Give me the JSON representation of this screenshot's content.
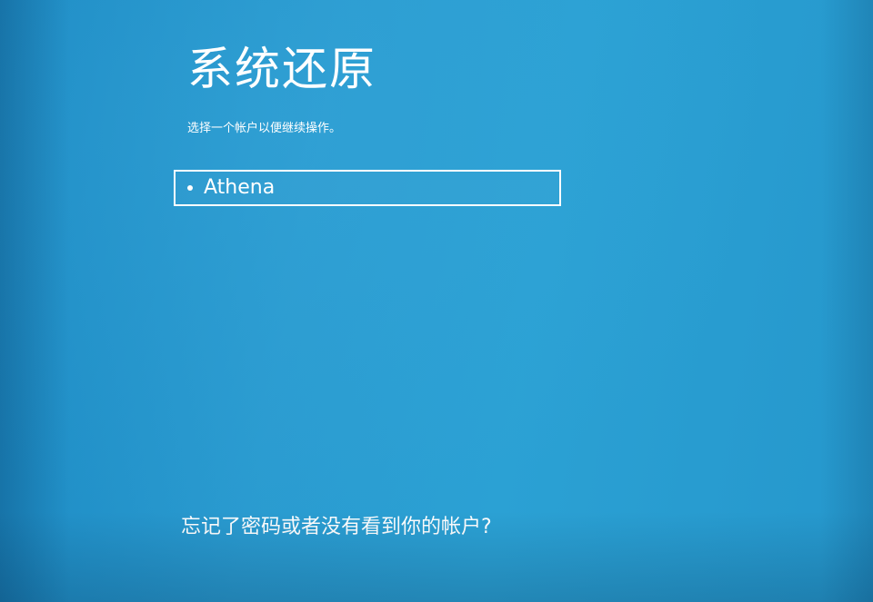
{
  "page": {
    "title": "系统还原",
    "subtitle": "选择一个帐户以便继续操作。"
  },
  "accounts": [
    {
      "name": "Athena",
      "selected": true
    }
  ],
  "footer": {
    "forgot_link": "忘记了密码或者没有看到你的帐户?"
  },
  "colors": {
    "background": "#2a9bd0",
    "text": "#ffffff",
    "selection_border": "#ffffff"
  }
}
